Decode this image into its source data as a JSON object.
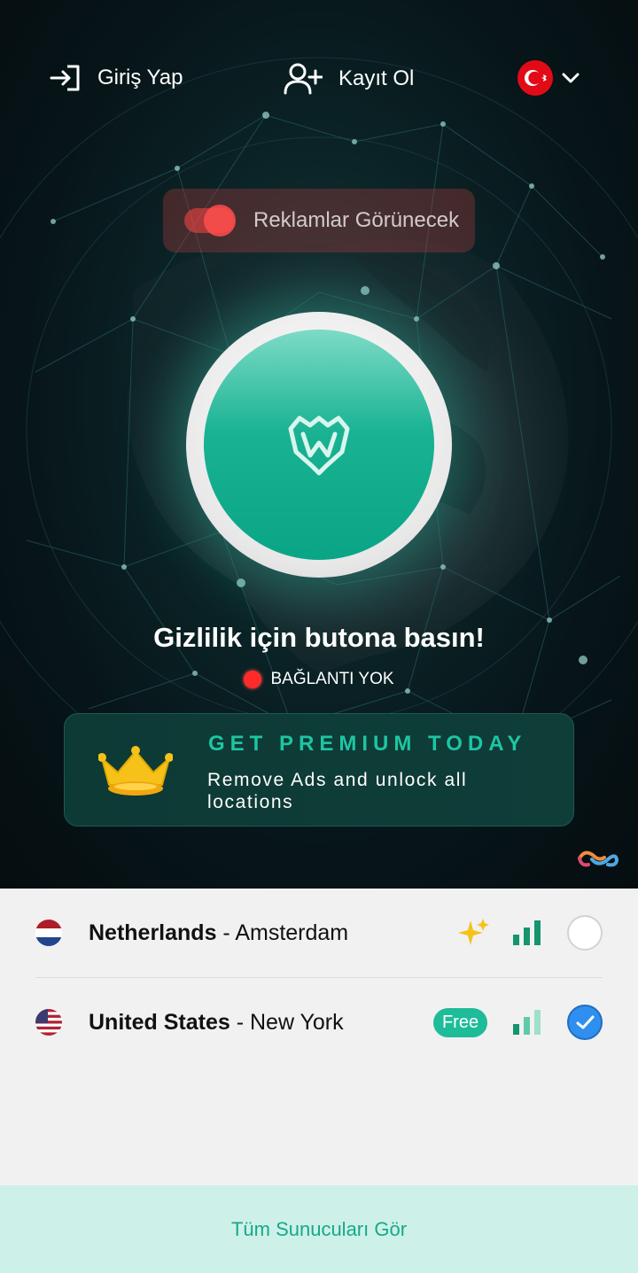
{
  "header": {
    "login_label": "Giriş Yap",
    "register_label": "Kayıt Ol",
    "language_flag": "turkey-flag"
  },
  "ads_toggle": {
    "label": "Reklamlar Görünecek",
    "enabled": true
  },
  "connect": {
    "cta": "Gizlilik için butona basın!",
    "status": "BAĞLANTI YOK",
    "status_color": "#ff2a2a"
  },
  "premium": {
    "title": "GET PREMIUM TODAY",
    "subtitle": "Remove Ads and unlock all locations"
  },
  "servers": [
    {
      "country": "Netherlands",
      "separator": " - ",
      "city": "Amsterdam",
      "badge": "premium-sparkle-icon",
      "signal": "signal-strong",
      "selected": false
    },
    {
      "country": "United States",
      "separator": " - ",
      "city": "New York",
      "badge": "Free",
      "signal": "signal-medium",
      "selected": true
    }
  ],
  "footer": {
    "all_servers_label": "Tüm Sunucuları Gör"
  },
  "colors": {
    "accent": "#1ebc99",
    "premium_title": "#1dc5a3",
    "selected_radio": "#2f8ff0"
  }
}
